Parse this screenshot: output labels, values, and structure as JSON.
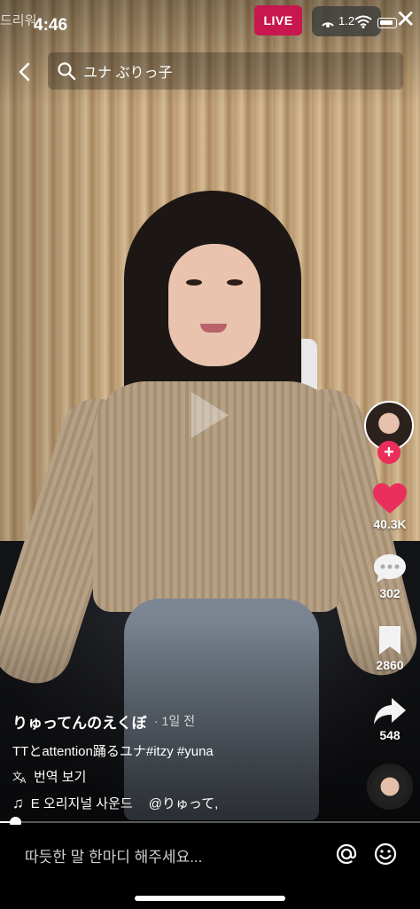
{
  "status_bar": {
    "back_app": "드리워",
    "time": "4:46",
    "live_label": "LIVE",
    "signal_count": "1.2"
  },
  "search": {
    "query": "ユナ ぶりっ子"
  },
  "rail": {
    "likes": "40.3K",
    "comments": "302",
    "saves": "2860",
    "shares": "548",
    "like_color": "#ea2e5b",
    "follow_color": "#ea2e5b"
  },
  "post": {
    "author": "りゅってんのえくぼ",
    "ago": "· 1일 전",
    "caption": "TTとattention踊るユナ#itzy #yuna",
    "translate_label": "번역 보기",
    "sound_text": "E 오리지널 사운드",
    "sound_author": "@りゅって,"
  },
  "playback": {
    "progress": 0.03
  },
  "comment_bar": {
    "placeholder": "따듯한 말 한마디 해주세요..."
  },
  "icons": [
    "back-icon",
    "search-icon",
    "heart-icon",
    "comment-icon",
    "bookmark-icon",
    "share-icon",
    "translate-icon",
    "music-note-icon",
    "mention-icon",
    "emoji-icon",
    "close-icon"
  ]
}
